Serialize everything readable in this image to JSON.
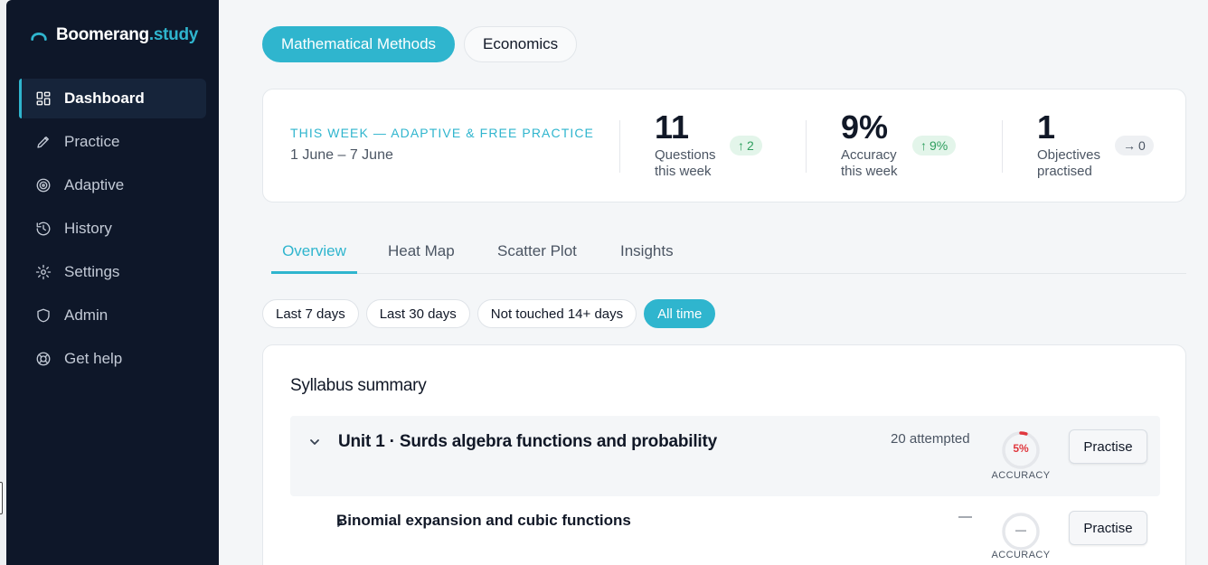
{
  "brand": {
    "name": "Boomerang",
    "suffix": ".study"
  },
  "sidebar": {
    "items": [
      {
        "label": "Dashboard",
        "icon": "dashboard-icon",
        "active": true
      },
      {
        "label": "Practice",
        "icon": "pencil-icon"
      },
      {
        "label": "Adaptive",
        "icon": "target-icon"
      },
      {
        "label": "History",
        "icon": "history-icon"
      },
      {
        "label": "Settings",
        "icon": "gear-icon"
      },
      {
        "label": "Admin",
        "icon": "shield-icon"
      },
      {
        "label": "Get help",
        "icon": "lifebuoy-icon"
      }
    ]
  },
  "subjects": [
    "Mathematical Methods",
    "Economics"
  ],
  "stats": {
    "week_title": "THIS WEEK — ADAPTIVE & FREE PRACTICE",
    "week_range": "1 June – 7 June",
    "questions": {
      "value": "11",
      "label_line1": "Questions",
      "label_line2": "this week",
      "delta": "2",
      "delta_icon": "arrow-up-icon"
    },
    "accuracy": {
      "value": "9%",
      "label_line1": "Accuracy",
      "label_line2": "this week",
      "delta": "9%",
      "delta_icon": "arrow-up-icon"
    },
    "objectives": {
      "value": "1",
      "label_line1": "Objectives",
      "label_line2": "practised",
      "delta": "0",
      "delta_icon": "arrow-right-icon"
    }
  },
  "view_tabs": [
    "Overview",
    "Heat Map",
    "Scatter Plot",
    "Insights"
  ],
  "filters": [
    "Last 7 days",
    "Last 30 days",
    "Not touched 14+ days",
    "All time"
  ],
  "summary": {
    "title": "Syllabus summary",
    "unit": {
      "title": "Unit 1 · Surds algebra functions and probability",
      "attempted": "20 attempted",
      "accuracy": "5%",
      "accuracy_fraction": 0.05,
      "accuracy_label": "ACCURACY",
      "button": "Practise"
    },
    "topic": {
      "title": "Binomial expansion and cubic functions",
      "attempted": "—",
      "accuracy": "—",
      "accuracy_label": "ACCURACY",
      "button": "Practise"
    }
  },
  "colors": {
    "accent": "#2fb5ce",
    "sidebar_bg": "#0e1729",
    "danger": "#e0383e",
    "success": "#2e9e5e"
  }
}
